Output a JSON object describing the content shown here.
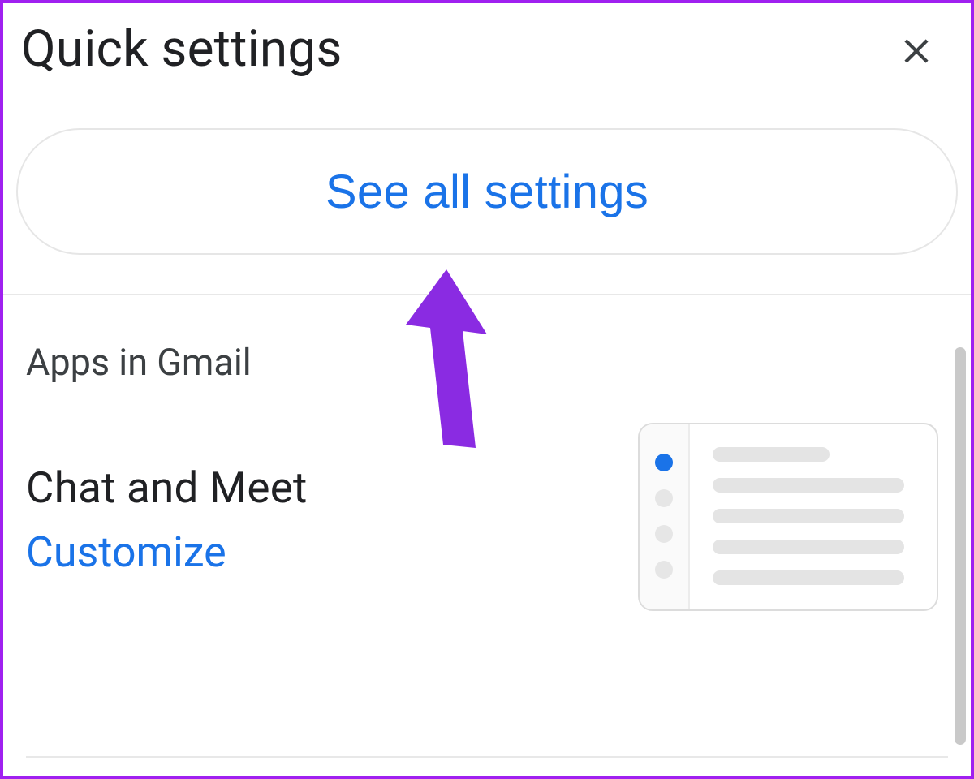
{
  "header": {
    "title": "Quick settings"
  },
  "actions": {
    "see_all_settings": "See all settings"
  },
  "sections": {
    "apps_in_gmail": {
      "heading": "Apps in Gmail",
      "chat_and_meet": {
        "title": "Chat and Meet",
        "customize": "Customize"
      }
    }
  },
  "annotation": {
    "cursor_color": "#8a2be2"
  }
}
